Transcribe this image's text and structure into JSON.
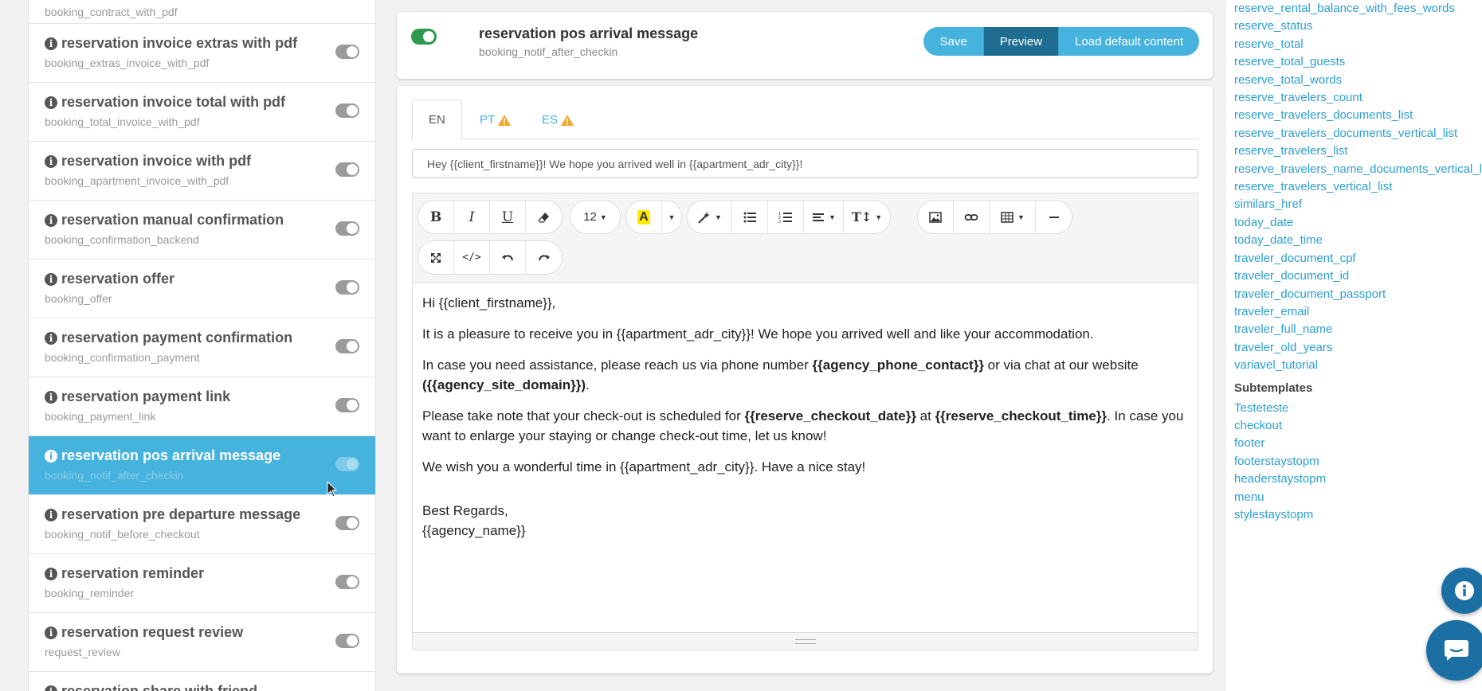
{
  "templates": {
    "top_partial_code": "booking_contract_with_pdf",
    "items": [
      {
        "name": "reservation invoice extras with pdf",
        "code": "booking_extras_invoice_with_pdf"
      },
      {
        "name": "reservation invoice total with pdf",
        "code": "booking_total_invoice_with_pdf"
      },
      {
        "name": "reservation invoice with pdf",
        "code": "booking_apartment_invoice_with_pdf"
      },
      {
        "name": "reservation manual confirmation",
        "code": "booking_confirmation_backend"
      },
      {
        "name": "reservation offer",
        "code": "booking_offer"
      },
      {
        "name": "reservation payment confirmation",
        "code": "booking_confirmation_payment"
      },
      {
        "name": "reservation payment link",
        "code": "booking_payment_link"
      },
      {
        "name": "reservation pos arrival message",
        "code": "booking_notif_after_checkin"
      },
      {
        "name": "reservation pre departure message",
        "code": "booking_notif_before_checkout"
      },
      {
        "name": "reservation reminder",
        "code": "booking_reminder"
      },
      {
        "name": "reservation request review",
        "code": "request_review"
      }
    ],
    "bottom_partial_name": "reservation share with friend"
  },
  "header": {
    "title": "reservation pos arrival message",
    "code": "booking_notif_after_checkin",
    "buttons": {
      "save": "Save",
      "preview": "Preview",
      "load_default": "Load default content"
    }
  },
  "editor": {
    "tabs": {
      "en": "EN",
      "pt": "PT",
      "es": "ES"
    },
    "subject": "Hey {{client_firstname}}! We hope you arrived well in {{apartment_adr_city}}!",
    "font_size": "12",
    "content": {
      "greeting": "Hi {{client_firstname}},",
      "p1": "It is a pleasure to receive you in {{apartment_adr_city}}! We hope you arrived well and like your accommodation.",
      "p2_a": "In case you need assistance, please reach us via phone number ",
      "p2_b": "{{agency_phone_contact}}",
      "p2_c": " or via chat at our website ",
      "p2_d": "({{agency_site_domain}})",
      "p2_e": ".",
      "p3_a": "Please take note that your check-out is scheduled for ",
      "p3_b": "{{reserve_checkout_date}}",
      "p3_c": " at ",
      "p3_d": "{{reserve_checkout_time}}",
      "p3_e": ". In case you want to enlarge your staying or change check-out time, let us know!",
      "p4": "We wish you a wonderful time in {{apartment_adr_city}}. Have a nice stay!",
      "regards": "Best Regards,",
      "signature": "{{agency_name}}"
    }
  },
  "variables": {
    "items": [
      "reserve_rental_balance_with_fees_words",
      "reserve_status",
      "reserve_total",
      "reserve_total_guests",
      "reserve_total_words",
      "reserve_travelers_count",
      "reserve_travelers_documents_list",
      "reserve_travelers_documents_vertical_list",
      "reserve_travelers_list",
      "reserve_travelers_name_documents_vertical_list",
      "reserve_travelers_vertical_list",
      "similars_href",
      "today_date",
      "today_date_time",
      "traveler_document_cpf",
      "traveler_document_id",
      "traveler_document_passport",
      "traveler_email",
      "traveler_full_name",
      "traveler_old_years",
      "variavel_tutorial"
    ],
    "subtemplates_heading": "Subtemplates",
    "subtemplates": [
      "Testeteste",
      "checkout",
      "footer",
      "footerstaystopm",
      "headerstaystopm",
      "menu",
      "stylestaystopm"
    ]
  },
  "colors": {
    "accent": "#46b3de",
    "dark_accent": "#1f6e91",
    "link": "#2a9fd6",
    "toggle_on": "#2e9a4e"
  }
}
